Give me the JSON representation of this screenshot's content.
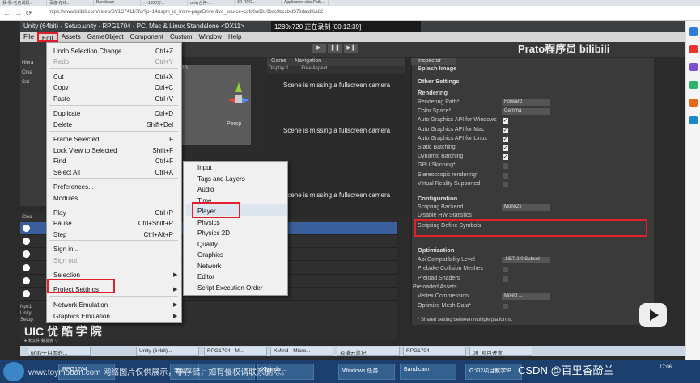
{
  "browser": {
    "tabs": [
      "我-我-老店试题...",
      "百度-在线...",
      "Bandicam",
      "...-1000万...",
      "unity合并-...",
      "3D RPG...",
      "Application.dataPath..."
    ],
    "url": "https://www.bilibili.com/video/BV1C7411i7fq/?p=14&spm_id_from=pageDriver&vd_source=cdfd0a0810bcc9bccbcf373dafdf6a82"
  },
  "unity": {
    "title": "Unity (64bit) - Setup.unity - RPG1704 - PC, Mac & Linux Standalone <DX11>",
    "recording": "1280x720  正在录制 [00:12:39]",
    "menus": [
      "File",
      "Edit",
      "Assets",
      "GameObject",
      "Component",
      "Custom",
      "Window",
      "Help"
    ],
    "play_buttons": [
      "▶",
      "❚❚",
      "▶❚"
    ],
    "watermark": "Prato程序员 bilibili"
  },
  "edit_menu": [
    {
      "label": "Undo Selection Change",
      "shortcut": "Ctrl+Z",
      "disabled": false
    },
    {
      "label": "Redo",
      "shortcut": "Ctrl+Y",
      "disabled": true
    },
    {
      "label": "Cut",
      "shortcut": "Ctrl+X",
      "disabled": false
    },
    {
      "label": "Copy",
      "shortcut": "Ctrl+C",
      "disabled": false
    },
    {
      "label": "Paste",
      "shortcut": "Ctrl+V",
      "disabled": false
    },
    {
      "label": "Duplicate",
      "shortcut": "Ctrl+D",
      "disabled": false
    },
    {
      "label": "Delete",
      "shortcut": "Shift+Del",
      "disabled": false
    },
    {
      "label": "Frame Selected",
      "shortcut": "F",
      "disabled": false
    },
    {
      "label": "Lock View to Selected",
      "shortcut": "Shift+F",
      "disabled": false
    },
    {
      "label": "Find",
      "shortcut": "Ctrl+F",
      "disabled": false
    },
    {
      "label": "Select All",
      "shortcut": "Ctrl+A",
      "disabled": false
    },
    {
      "label": "Preferences...",
      "shortcut": "",
      "disabled": false
    },
    {
      "label": "Modules...",
      "shortcut": "",
      "disabled": false
    },
    {
      "label": "Play",
      "shortcut": "Ctrl+P",
      "disabled": false
    },
    {
      "label": "Pause",
      "shortcut": "Ctrl+Shift+P",
      "disabled": false
    },
    {
      "label": "Step",
      "shortcut": "Ctrl+Alt+P",
      "disabled": false
    },
    {
      "label": "Sign in...",
      "shortcut": "",
      "disabled": false
    },
    {
      "label": "Sign out",
      "shortcut": "",
      "disabled": true
    },
    {
      "label": "Selection",
      "shortcut": "",
      "disabled": false,
      "submenu": true
    },
    {
      "label": "Project Settings",
      "shortcut": "",
      "disabled": false,
      "submenu": true
    },
    {
      "label": "Network Emulation",
      "shortcut": "",
      "disabled": false,
      "submenu": true
    },
    {
      "label": "Graphics Emulation",
      "shortcut": "",
      "disabled": false,
      "submenu": true
    }
  ],
  "project_settings_menu": [
    "Input",
    "Tags and Layers",
    "Audio",
    "Time",
    "Player",
    "Physics",
    "Physics 2D",
    "Quality",
    "Graphics",
    "Network",
    "Editor",
    "Script Execution Order"
  ],
  "game_view": {
    "tabs": [
      "Game",
      "Navigation"
    ],
    "display": "Display 1",
    "aspect": "Free Aspect",
    "messages": [
      "Scene is missing a fullscreen camera",
      "Scene is missing a fullscreen camera",
      "Scene is missing a fullscreen camera"
    ],
    "scene_label": "Persp",
    "scene_mode": "2D"
  },
  "inspector": {
    "tab": "Inspector",
    "splash": "Splash Image",
    "other_settings": "Other Settings",
    "rendering": "Rendering",
    "rows": [
      {
        "label": "Rendering Path*",
        "value": "Forward"
      },
      {
        "label": "Color Space*",
        "value": "Gamma"
      },
      {
        "label": "Auto Graphics API for Windows",
        "check": true
      },
      {
        "label": "Auto Graphics API for Mac",
        "check": true
      },
      {
        "label": "Auto Graphics API for Linux",
        "check": true
      },
      {
        "label": "Static Batching",
        "check": true
      },
      {
        "label": "Dynamic Batching",
        "check": true
      },
      {
        "label": "GPU Skinning*",
        "check": false
      },
      {
        "label": "Stereoscopic rendering*",
        "check": false
      },
      {
        "label": "Virtual Reality Supported",
        "check": false
      }
    ],
    "configuration": "Configuration",
    "scripting_backend": {
      "label": "Scripting Backend",
      "value": "Mono2x"
    },
    "disable_hw": "Disable HW Statistics",
    "scripting_define": "Scripting Define Symbols",
    "optimization": "Optimization",
    "opt_rows": [
      {
        "label": "Api Compatibility Level",
        "value": ".NET 2.0 Subset"
      },
      {
        "label": "Prebake Collision Meshes",
        "check": false
      },
      {
        "label": "Preload Shaders",
        "check": false
      },
      {
        "label": "Preloaded Assets",
        "check": null
      },
      {
        "label": "Vertex Compression",
        "value": "Mixed ..."
      },
      {
        "label": "Optimize Mesh Data*",
        "check": false
      }
    ],
    "note": "* Shared setting between multiple platforms."
  },
  "hierarchy": {
    "labels": [
      "Hiera",
      "Crea",
      "Set"
    ]
  },
  "console": {
    "label": "Clea",
    "npc_lines": [
      "Npc1",
      "Unity",
      "Setup"
    ]
  },
  "logo": {
    "text": "UIC 优 酷 学 院",
    "sub": "● 未文件 新发表 ▽"
  },
  "unity_taskbar": [
    "unity于白雨的...",
    "Unity (64bit)...",
    "RPG1704 - Mi...",
    "XMind - Micro...",
    "有道云笔记",
    "RPG1704",
    "00_项目进度"
  ],
  "windows_taskbar": [
    "RPG1704",
    "学习",
    "...",
    "XMind - ...",
    "Windows 任务...",
    "Bandicam",
    "G:\\02项目教学\\P..."
  ],
  "clock": "17:06",
  "overlay_watermark": "www.toymoban.com 网络图片仅供展示，非存储，如有侵权请联系删除。",
  "csdn": "CSDN @百里香酚兰"
}
